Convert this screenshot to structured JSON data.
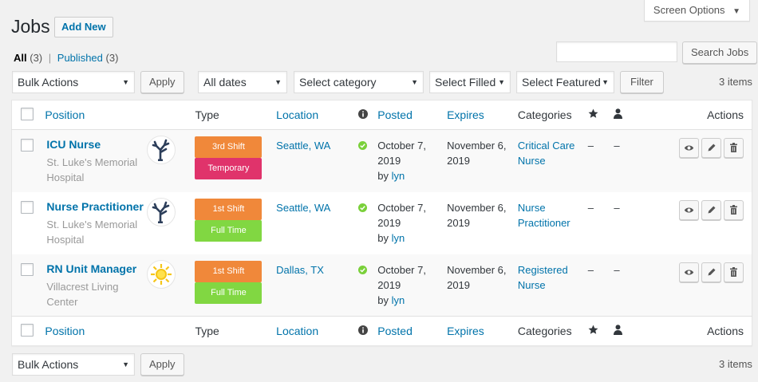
{
  "screen_options": {
    "label": "Screen Options",
    "arrow": "▼"
  },
  "page": {
    "title": "Jobs",
    "add_new": "Add New"
  },
  "views": {
    "all_label": "All",
    "all_count": "(3)",
    "separator": "|",
    "published_label": "Published",
    "published_count": "(3)"
  },
  "search": {
    "value": "",
    "button": "Search Jobs"
  },
  "filters": {
    "bulk_actions": "Bulk Actions",
    "apply": "Apply",
    "dates": "All dates",
    "category": "Select category",
    "filled": "Select Filled",
    "featured": "Select Featured",
    "filter_button": "Filter",
    "items_count": "3 items"
  },
  "columns": {
    "position": "Position",
    "type": "Type",
    "location": "Location",
    "info_icon": "info-icon",
    "posted": "Posted",
    "expires": "Expires",
    "categories": "Categories",
    "featured_icon": "star-icon",
    "filled_icon": "user-icon",
    "actions": "Actions"
  },
  "colors": {
    "third_shift": "#f0883a",
    "first_shift": "#f0883a",
    "temporary": "#e0336b",
    "full_time": "#81d742",
    "check": "#7ad03a",
    "link": "#0073aa"
  },
  "rows": [
    {
      "title": "ICU Nurse",
      "company": "St. Luke's Memorial Hospital",
      "logo": "tree-logo",
      "types": [
        {
          "label": "3rd Shift",
          "color": "#f0883a"
        },
        {
          "label": "Temporary",
          "color": "#e0336b"
        }
      ],
      "location": "Seattle, WA",
      "posted_date": "October 7, 2019",
      "posted_by_prefix": "by",
      "posted_by": "lyn",
      "expires": "November 6, 2019",
      "category": "Critical Care Nurse",
      "featured": "–",
      "filled": "–"
    },
    {
      "title": "Nurse Practitioner",
      "company": "St. Luke's Memorial Hospital",
      "logo": "tree-logo",
      "types": [
        {
          "label": "1st Shift",
          "color": "#f0883a"
        },
        {
          "label": "Full Time",
          "color": "#81d742"
        }
      ],
      "location": "Seattle, WA",
      "posted_date": "October 7, 2019",
      "posted_by_prefix": "by",
      "posted_by": "lyn",
      "expires": "November 6, 2019",
      "category": "Nurse Practitioner",
      "featured": "–",
      "filled": "–"
    },
    {
      "title": "RN Unit Manager",
      "company": "Villacrest Living Center",
      "logo": "sun-logo",
      "types": [
        {
          "label": "1st Shift",
          "color": "#f0883a"
        },
        {
          "label": "Full Time",
          "color": "#81d742"
        }
      ],
      "location": "Dallas, TX",
      "posted_date": "October 7, 2019",
      "posted_by_prefix": "by",
      "posted_by": "lyn",
      "expires": "November 6, 2019",
      "category": "Registered Nurse",
      "featured": "–",
      "filled": "–"
    }
  ],
  "row_actions": [
    "view-icon",
    "edit-icon",
    "delete-icon"
  ]
}
